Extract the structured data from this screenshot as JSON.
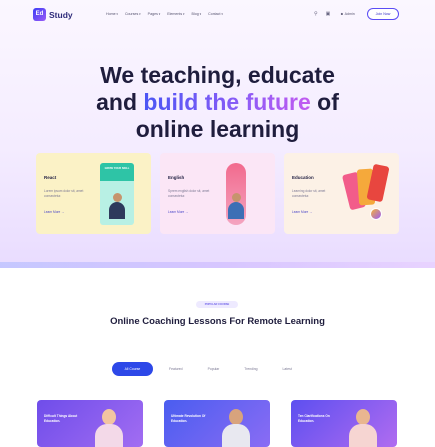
{
  "header": {
    "logo_mark": "Ed",
    "logo_text": "Study",
    "nav": [
      "Home",
      "Courses",
      "Pages",
      "Elements",
      "Blog",
      "Contact"
    ],
    "admin_label": "Admin",
    "join_label": "Join Now",
    "icons": [
      "search-icon",
      "cart-icon"
    ]
  },
  "hero": {
    "line1": "We teaching, educate",
    "line2_pre": "and",
    "line2_accent": "build the future",
    "line2_post": "of",
    "line3": "online learning"
  },
  "cards": [
    {
      "title": "React",
      "desc": "Lorem ipsum dolor sit, amet consectetur.",
      "link": "Learn More →",
      "book_text": "GROW YOUR SKILL"
    },
    {
      "title": "English",
      "desc": "Sprem english dolor sit, amet consectetur.",
      "link": "Learn More →"
    },
    {
      "title": "Education",
      "desc": "Learning dolor sit, amet consectetur.",
      "link": "Learn More →"
    }
  ],
  "courses_section": {
    "tag": "POPULAR COURSE",
    "title": "Online Coaching Lessons For Remote Learning",
    "filters": [
      "All Course",
      "Featured",
      "Popular",
      "Trending",
      "Latest"
    ],
    "active_filter": "All Course"
  },
  "course_cards": [
    {
      "text": "Difficult Things About Education."
    },
    {
      "text": "Ultimate Revolution Of Education."
    },
    {
      "text": "Ten Clarifications On Education."
    }
  ],
  "colors": {
    "accent": "#2d48e8",
    "brand": "#5b4cf5",
    "card_react": "#fbf2c6",
    "card_english": "#fbe6f6",
    "card_education": "#fcf1e6"
  }
}
